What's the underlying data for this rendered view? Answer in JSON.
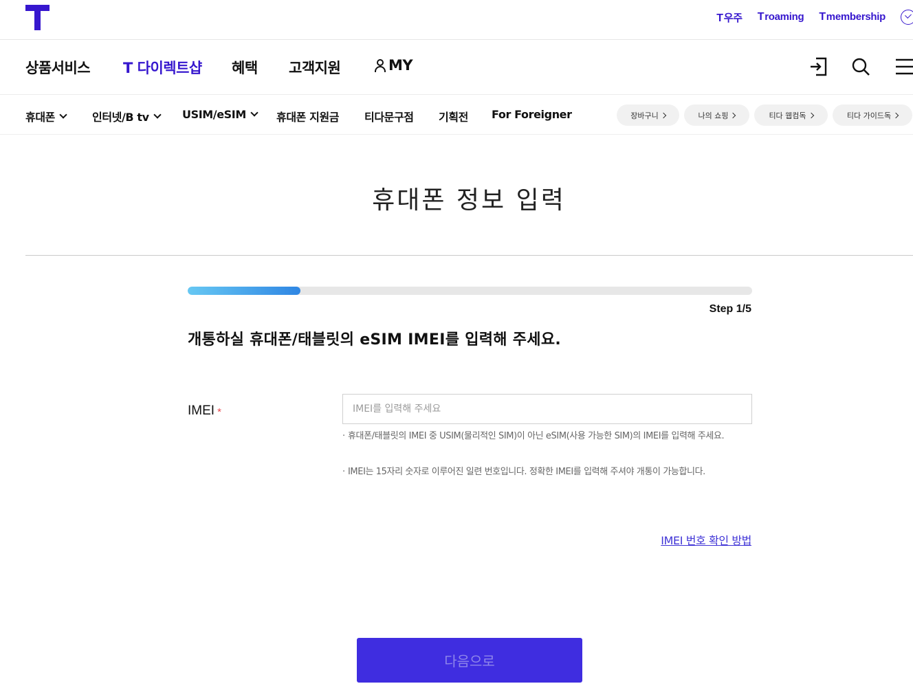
{
  "header": {
    "util_links": [
      {
        "mark": "T",
        "label": "우주"
      },
      {
        "mark": "T",
        "label": "roaming"
      },
      {
        "mark": "T",
        "label": "membership"
      }
    ]
  },
  "gnb": {
    "items": [
      "상품서비스",
      "T 다이렉트샵",
      "혜택",
      "고객지원"
    ],
    "my_label": "MY"
  },
  "subnav": {
    "items": [
      "휴대폰",
      "인터넷/B tv",
      "USIM/eSIM",
      "휴대폰 지원금",
      "티다문구점",
      "기획전",
      "For Foreigner"
    ],
    "pills": [
      "장바구니",
      "나의 쇼핑",
      "티다 웹컴독",
      "티다 가이드독"
    ]
  },
  "page": {
    "title": "휴대폰 정보 입력",
    "progress": 0.2,
    "step_label": "Step 1/5",
    "question": "개통하실 휴대폰/태블릿의 eSIM IMEI를 입력해 주세요."
  },
  "form": {
    "imei_label": "IMEI",
    "required_mark": "*",
    "imei_placeholder": "IMEI를 입력해 주세요",
    "imei_value": "",
    "hints": [
      "휴대폰/태블릿의 IMEI 중 USIM(물리적인 SIM)이 아닌 eSIM(사용 가능한 SIM)의 IMEI를 입력해 주세요.",
      "IMEI는 15자리 숫자로 이루어진 일련 번호입니다. 정확한 IMEI를 입력해 주셔야 개통이 가능합니다."
    ],
    "help_link": "IMEI 번호 확인 방법",
    "next_button": "다음으로"
  },
  "colors": {
    "brand": "#3617ce",
    "button": "#3f2de0",
    "progress_start": "#67c8f3",
    "progress_end": "#2f86e3",
    "required": "#e8474b"
  },
  "icons": [
    "t-logo-icon",
    "login-icon",
    "search-icon",
    "menu-icon",
    "person-icon",
    "check-circle-icon"
  ]
}
